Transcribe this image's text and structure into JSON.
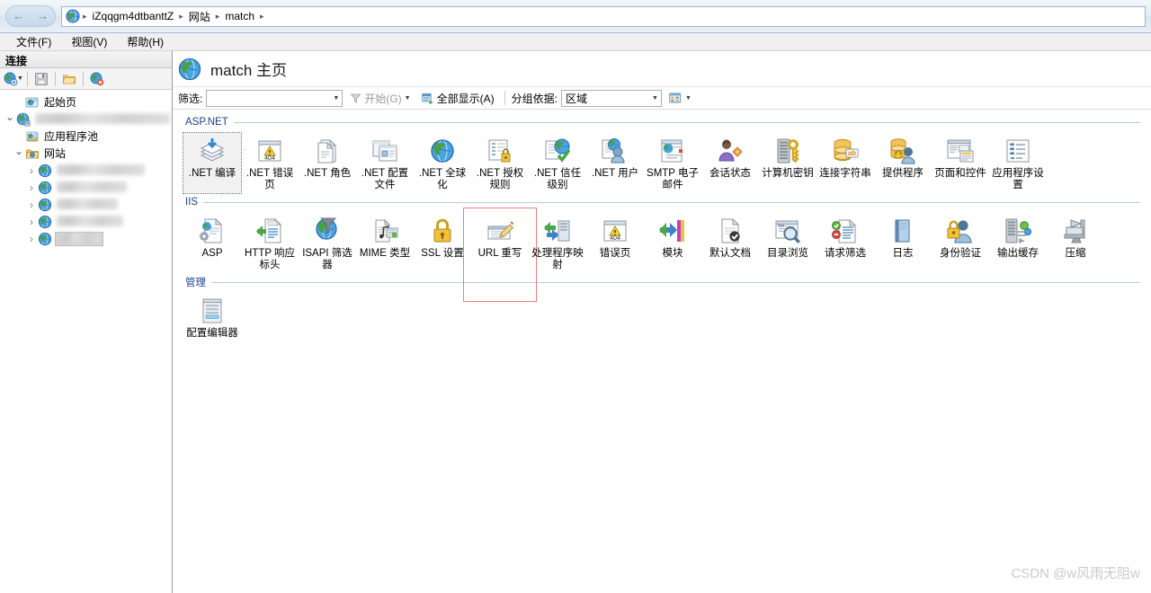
{
  "window": {
    "nav": {
      "back": "←",
      "forward": "→"
    },
    "breadcrumb": [
      "iZqqgm4dtbanttZ",
      "网站",
      "match"
    ],
    "breadcrumb_separator": "▸"
  },
  "menubar": [
    {
      "label": "文件(F)",
      "name": "menu-file"
    },
    {
      "label": "视图(V)",
      "name": "menu-view"
    },
    {
      "label": "帮助(H)",
      "name": "menu-help"
    }
  ],
  "sidebar": {
    "title": "连接",
    "toolbar": [
      {
        "name": "connect-to-server-icon",
        "label": ""
      },
      {
        "name": "save-connections-icon",
        "label": ""
      },
      {
        "name": "open-folder-icon",
        "label": ""
      },
      {
        "name": "delete-connection-icon",
        "label": ""
      }
    ],
    "tree": [
      {
        "label": "起始页",
        "indent": 1,
        "twisty": "none",
        "icon": "start-page-icon",
        "blurred": false,
        "selected": false
      },
      {
        "label": "iZqqgm4dtbanttZ (iZqqgm4db",
        "indent": 0,
        "twisty": "expanded",
        "icon": "server-icon",
        "blurred": true,
        "blur_width": 150,
        "selected": false
      },
      {
        "label": "应用程序池",
        "indent": 1,
        "twisty": "none",
        "icon": "app-pools-icon",
        "blurred": false,
        "selected": false
      },
      {
        "label": "网站",
        "indent": 1,
        "twisty": "expanded",
        "icon": "sites-folder-icon",
        "blurred": false,
        "selected": false
      },
      {
        "label": "site-1",
        "indent": 2,
        "twisty": "collapsed",
        "icon": "site-icon",
        "blurred": true,
        "blur_width": 98,
        "selected": false
      },
      {
        "label": "site-2",
        "indent": 2,
        "twisty": "collapsed",
        "icon": "site-icon",
        "blurred": true,
        "blur_width": 78,
        "selected": false
      },
      {
        "label": "site-3",
        "indent": 2,
        "twisty": "collapsed",
        "icon": "site-icon",
        "blurred": true,
        "blur_width": 68,
        "selected": false
      },
      {
        "label": "site-4",
        "indent": 2,
        "twisty": "collapsed",
        "icon": "site-icon",
        "blurred": true,
        "blur_width": 74,
        "selected": false
      },
      {
        "label": "match",
        "indent": 2,
        "twisty": "collapsed",
        "icon": "site-icon",
        "blurred": true,
        "blur_width": 46,
        "selected": true
      }
    ]
  },
  "content": {
    "title": "match 主页",
    "title_icon": "site-globe-icon",
    "filter": {
      "filter_label": "筛选:",
      "filter_value": "",
      "filter_placeholder": "",
      "go_label": "开始(G)",
      "show_all_label": "全部显示(A)",
      "group_by_label": "分组依据:",
      "group_by_value": "区域",
      "view_icon": "view-mode-icon"
    },
    "groups": [
      {
        "name": "ASP.NET",
        "items": [
          {
            "label": ".NET 编译",
            "icon": "net-compilation-icon",
            "selected": true
          },
          {
            "label": ".NET 错误页",
            "icon": "net-error-pages-icon",
            "selected": false
          },
          {
            "label": ".NET 角色",
            "icon": "net-roles-icon",
            "selected": false
          },
          {
            "label": ".NET 配置文件",
            "icon": "net-profile-icon",
            "selected": false
          },
          {
            "label": ".NET 全球化",
            "icon": "net-globalization-icon",
            "selected": false
          },
          {
            "label": ".NET 授权规则",
            "icon": "net-authorization-rules-icon",
            "selected": false
          },
          {
            "label": ".NET 信任级别",
            "icon": "net-trust-levels-icon",
            "selected": false
          },
          {
            "label": ".NET 用户",
            "icon": "net-users-icon",
            "selected": false
          },
          {
            "label": "SMTP 电子邮件",
            "icon": "smtp-email-icon",
            "selected": false
          },
          {
            "label": "会话状态",
            "icon": "session-state-icon",
            "selected": false
          },
          {
            "label": "计算机密钥",
            "icon": "machine-key-icon",
            "selected": false
          },
          {
            "label": "连接字符串",
            "icon": "connection-strings-icon",
            "selected": false
          },
          {
            "label": "提供程序",
            "icon": "providers-icon",
            "selected": false
          },
          {
            "label": "页面和控件",
            "icon": "pages-and-controls-icon",
            "selected": false
          },
          {
            "label": "应用程序设置",
            "icon": "application-settings-icon",
            "selected": false
          }
        ]
      },
      {
        "name": "IIS",
        "items": [
          {
            "label": "ASP",
            "icon": "asp-icon",
            "selected": false
          },
          {
            "label": "HTTP 响应标头",
            "icon": "http-response-headers-icon",
            "selected": false
          },
          {
            "label": "ISAPI 筛选器",
            "icon": "isapi-filters-icon",
            "selected": false
          },
          {
            "label": "MIME 类型",
            "icon": "mime-types-icon",
            "selected": false
          },
          {
            "label": "SSL 设置",
            "icon": "ssl-settings-icon",
            "selected": false
          },
          {
            "label": "URL 重写",
            "icon": "url-rewrite-icon",
            "selected": false,
            "highlighted": true
          },
          {
            "label": "处理程序映射",
            "icon": "handler-mappings-icon",
            "selected": false
          },
          {
            "label": "错误页",
            "icon": "error-pages-icon",
            "selected": false
          },
          {
            "label": "模块",
            "icon": "modules-icon",
            "selected": false
          },
          {
            "label": "默认文档",
            "icon": "default-document-icon",
            "selected": false
          },
          {
            "label": "目录浏览",
            "icon": "directory-browsing-icon",
            "selected": false
          },
          {
            "label": "请求筛选",
            "icon": "request-filtering-icon",
            "selected": false
          },
          {
            "label": "日志",
            "icon": "logging-icon",
            "selected": false
          },
          {
            "label": "身份验证",
            "icon": "authentication-icon",
            "selected": false
          },
          {
            "label": "输出缓存",
            "icon": "output-caching-icon",
            "selected": false
          },
          {
            "label": "压缩",
            "icon": "compression-icon",
            "selected": false
          }
        ]
      },
      {
        "name": "管理",
        "items": [
          {
            "label": "配置编辑器",
            "icon": "configuration-editor-icon",
            "selected": false
          }
        ]
      }
    ]
  },
  "watermark": "CSDN @w风雨无阻w",
  "colors": {
    "accent": "#19438a",
    "highlight_box": "#f07a7f",
    "selection": "#d4d4d4"
  }
}
